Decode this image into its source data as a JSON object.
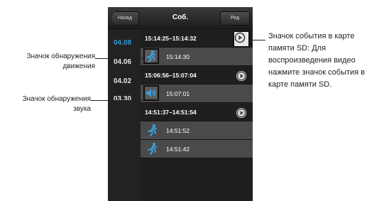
{
  "topbar": {
    "back_label": "Назад",
    "title": "Соб.",
    "edit_label": "Ред"
  },
  "dates": [
    {
      "label": "04.08",
      "active": true
    },
    {
      "label": "04.06",
      "active": false
    },
    {
      "label": "04.02",
      "active": false
    },
    {
      "label": "03.30",
      "active": false
    }
  ],
  "events": [
    {
      "kind": "sd",
      "time": "15:14:25–15:14:32"
    },
    {
      "kind": "motion",
      "time": "15:14:30"
    },
    {
      "kind": "sd",
      "time": "15:06:56–15:07:04"
    },
    {
      "kind": "sound",
      "time": "15:07:01"
    },
    {
      "kind": "sd",
      "time": "14:51:37–14:51:54"
    },
    {
      "kind": "motion",
      "time": "14:51:52"
    },
    {
      "kind": "motion",
      "time": "14:51:42"
    }
  ],
  "callouts": {
    "motion": "Значок обнаружения движения",
    "sound": "Значок обнаружения звука",
    "sd": "Значок события в карте памяти SD: Для воспроизведения видео нажмите значок события в карте памяти SD."
  },
  "colors": {
    "active_date": "#2f9bd6",
    "icon_blue": "#3aa0e0",
    "screen_bg": "#2b2b2b"
  },
  "icons": {
    "motion": "running-person-icon",
    "sound": "speaker-icon",
    "sd": "play-circle-icon"
  }
}
